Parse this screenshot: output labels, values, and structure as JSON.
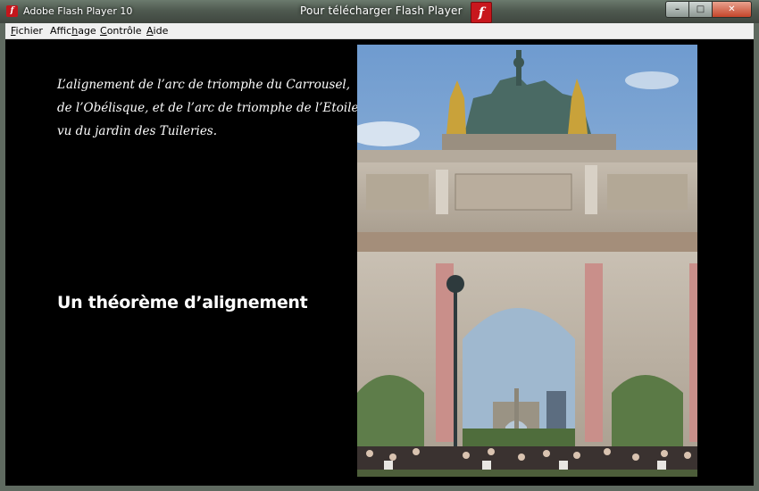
{
  "window": {
    "app_title": "Adobe Flash Player 10",
    "center_title": "Pour télécharger Flash Player",
    "controls": {
      "minimize": "–",
      "maximize": "□",
      "close": "✕"
    }
  },
  "menu": {
    "items": [
      {
        "prefix": "",
        "accel": "F",
        "rest": "ichier"
      },
      {
        "prefix": "Affic",
        "accel": "h",
        "rest": "age"
      },
      {
        "prefix": "",
        "accel": "C",
        "rest": "ontrôle"
      },
      {
        "prefix": "",
        "accel": "A",
        "rest": "ide"
      }
    ]
  },
  "slide": {
    "caption_lines": [
      "L’alignement de l’arc de triomphe du Carrousel,",
      "de l’Obélisque, et de l’arc de triomphe de l’Etoile",
      "vu du jardin des Tuileries."
    ],
    "heading": "Un théorème d’alignement"
  },
  "colors": {
    "stage_bg": "#000000",
    "flash_red": "#c8171d",
    "sky": "#8fb1d4"
  },
  "icons": {
    "app": "flash-player-icon",
    "center": "flash-logo-icon"
  }
}
